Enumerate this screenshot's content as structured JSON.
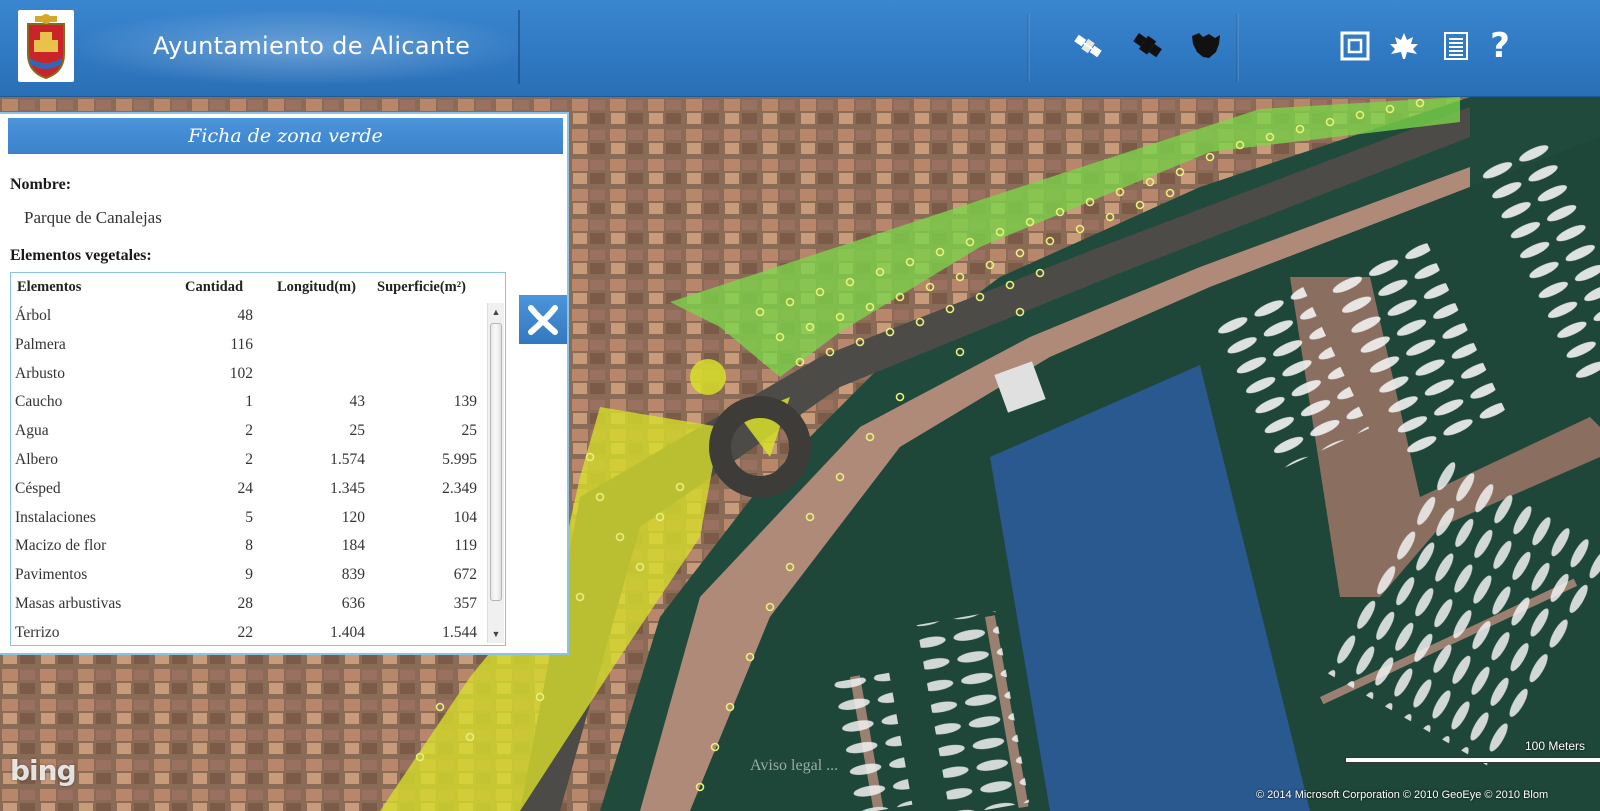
{
  "header": {
    "title": "Ayuntamiento de Alicante",
    "brand_color": "#3480c8",
    "tools": [
      {
        "icon": "satellite-icon"
      },
      {
        "icon": "aircraft-icon"
      },
      {
        "icon": "region-map-icon"
      }
    ],
    "actions": [
      {
        "icon": "frame-icon"
      },
      {
        "icon": "leaf-icon"
      },
      {
        "icon": "document-list-icon"
      },
      {
        "icon": "help-icon"
      }
    ]
  },
  "panel": {
    "title": "Ficha de zona verde",
    "nombre_label": "Nombre:",
    "nombre_value": "Parque de Canalejas",
    "elementos_label": "Elementos vegetales:",
    "columns": [
      "Elementos",
      "Cantidad",
      "Longitud(m)",
      "Superficie(m²)"
    ],
    "rows": [
      {
        "elemento": "Árbol",
        "cantidad": "48",
        "longitud": "",
        "superficie": ""
      },
      {
        "elemento": "Palmera",
        "cantidad": "116",
        "longitud": "",
        "superficie": ""
      },
      {
        "elemento": "Arbusto",
        "cantidad": "102",
        "longitud": "",
        "superficie": ""
      },
      {
        "elemento": "Caucho",
        "cantidad": "1",
        "longitud": "43",
        "superficie": "139"
      },
      {
        "elemento": "Agua",
        "cantidad": "2",
        "longitud": "25",
        "superficie": "25"
      },
      {
        "elemento": "Albero",
        "cantidad": "2",
        "longitud": "1.574",
        "superficie": "5.995"
      },
      {
        "elemento": "Césped",
        "cantidad": "24",
        "longitud": "1.345",
        "superficie": "2.349"
      },
      {
        "elemento": "Instalaciones",
        "cantidad": "5",
        "longitud": "120",
        "superficie": "104"
      },
      {
        "elemento": "Macizo de flor",
        "cantidad": "8",
        "longitud": "184",
        "superficie": "119"
      },
      {
        "elemento": "Pavimentos",
        "cantidad": "9",
        "longitud": "839",
        "superficie": "672"
      },
      {
        "elemento": "Masas arbustivas",
        "cantidad": "28",
        "longitud": "636",
        "superficie": "357"
      },
      {
        "elemento": "Terrizo",
        "cantidad": "22",
        "longitud": "1.404",
        "superficie": "1.544"
      }
    ]
  },
  "map": {
    "provider_logo": "bing",
    "legal_link": "Aviso legal ...",
    "scale_label": "100 Meters",
    "copyright": "© 2014 Microsoft Corporation   © 2010 GeoEye   © 2010 Blom",
    "green_zone_color": "#7cd64a",
    "yellow_zone_color": "#d8e02a",
    "water_zone_color": "#2d5fa8"
  }
}
